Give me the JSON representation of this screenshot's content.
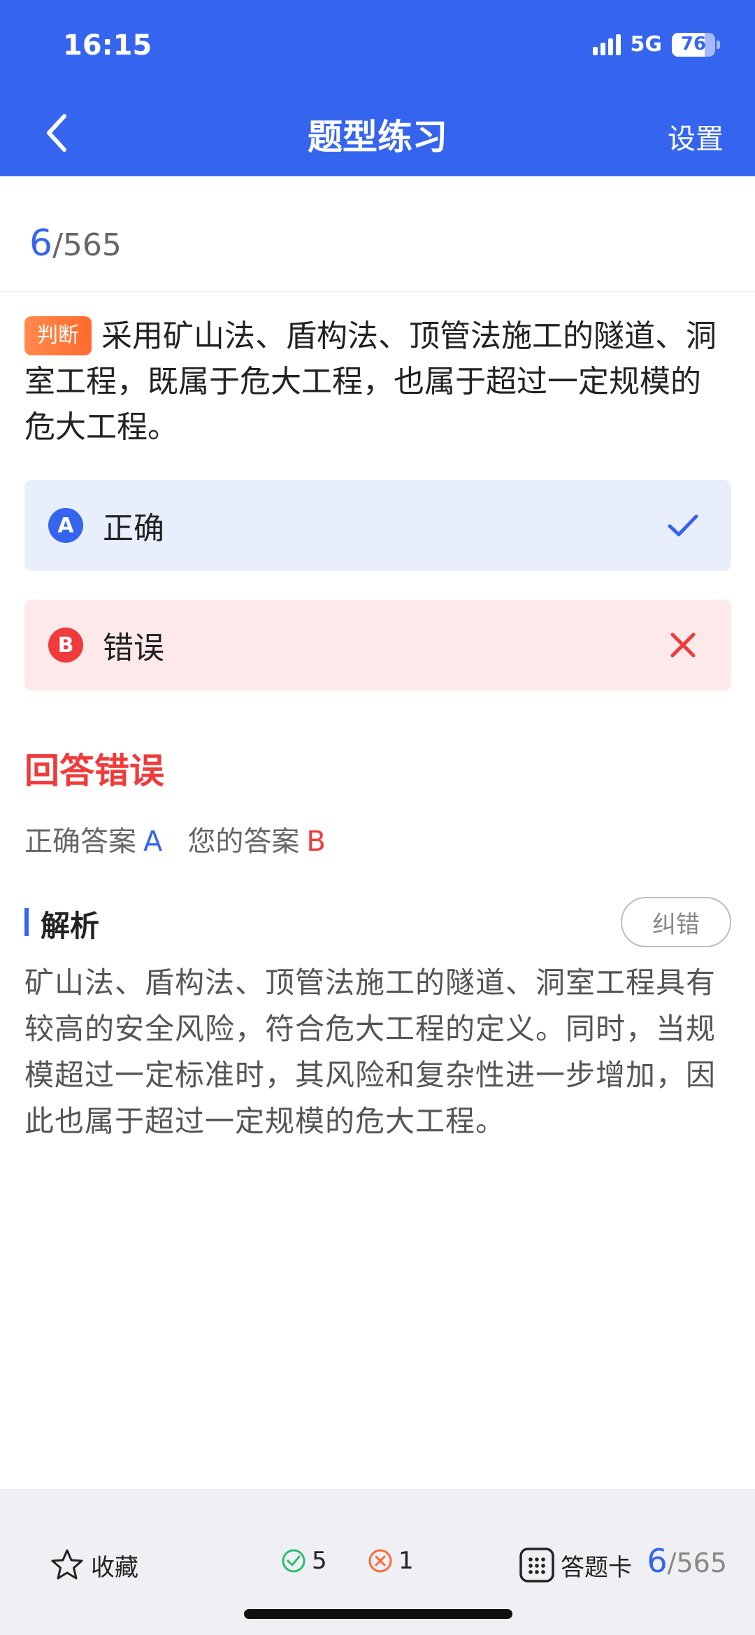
{
  "status_bar": {
    "time": "16:15",
    "network": "5G",
    "battery": "76",
    "battery_level": 0.76
  },
  "nav": {
    "title": "题型练习",
    "settings_label": "设置"
  },
  "progress": {
    "current": "6",
    "total": "/565"
  },
  "question": {
    "type_tag": "判断",
    "text": "采用矿山法、盾构法、顶管法施工的隧道、洞室工程，既属于危大工程，也属于超过一定规模的危大工程。"
  },
  "options": [
    {
      "key": "A",
      "label": "正确",
      "state": "correct"
    },
    {
      "key": "B",
      "label": "错误",
      "state": "wrong"
    }
  ],
  "result": {
    "title": "回答错误",
    "correct_label": "正确答案",
    "correct_value": "A",
    "yours_label": "您的答案",
    "yours_value": "B"
  },
  "analysis": {
    "title": "解析",
    "report_button": "纠错",
    "text": "矿山法、盾构法、顶管法施工的隧道、洞室工程具有较高的安全风险，符合危大工程的定义。同时，当规模超过一定标准时，其风险和复杂性进一步增加，因此也属于超过一定规模的危大工程。"
  },
  "footer": {
    "favorite_label": "收藏",
    "right_count": "5",
    "wrong_count": "1",
    "card_label": "答题卡",
    "page_current": "6",
    "page_total": "/565"
  },
  "colors": {
    "primary": "#3565ef",
    "error": "#ef3b3b",
    "tag": "#ff7a3c"
  }
}
